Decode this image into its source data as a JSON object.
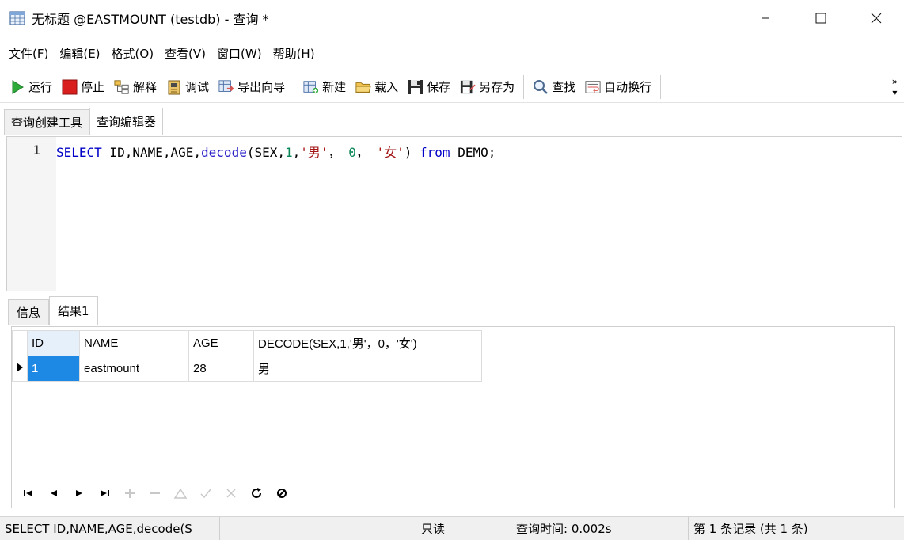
{
  "window": {
    "title": "无标题 @EASTMOUNT (testdb) - 查询 *"
  },
  "menu": [
    "文件(F)",
    "编辑(E)",
    "格式(O)",
    "查看(V)",
    "窗口(W)",
    "帮助(H)"
  ],
  "toolbar": {
    "run": "运行",
    "stop": "停止",
    "explain": "解释",
    "debug": "调试",
    "export_wizard": "导出向导",
    "new": "新建",
    "load": "载入",
    "save": "保存",
    "save_as": "另存为",
    "find": "查找",
    "word_wrap": "自动换行",
    "more": "»"
  },
  "tabs": {
    "builder": "查询创建工具",
    "editor": "查询编辑器"
  },
  "editor": {
    "line_number": "1",
    "sql_select": "SELECT",
    "sql_cols": " ID,NAME,AGE,",
    "sql_decode": "decode",
    "sql_open": "(SEX,",
    "sql_num1": "1",
    "sql_comma1": ",",
    "sql_str1": "'男'",
    "sql_comma2": "， ",
    "sql_num0": "0",
    "sql_comma3": "， ",
    "sql_str2": "'女'",
    "sql_close": ") ",
    "sql_from": "from",
    "sql_tail": " DEMO;"
  },
  "result_tabs": {
    "info": "信息",
    "result": "结果1"
  },
  "grid": {
    "columns": [
      "ID",
      "NAME",
      "AGE",
      "DECODE(SEX,1,'男'，0，'女')"
    ],
    "rows": [
      [
        "1",
        "eastmount",
        "28",
        "男"
      ]
    ]
  },
  "statusbar": {
    "sql": "SELECT ID,NAME,AGE,decode(S",
    "mode": "只读",
    "query_time": "查询时间: 0.002s",
    "records": "第 1 条记录 (共 1 条)"
  }
}
